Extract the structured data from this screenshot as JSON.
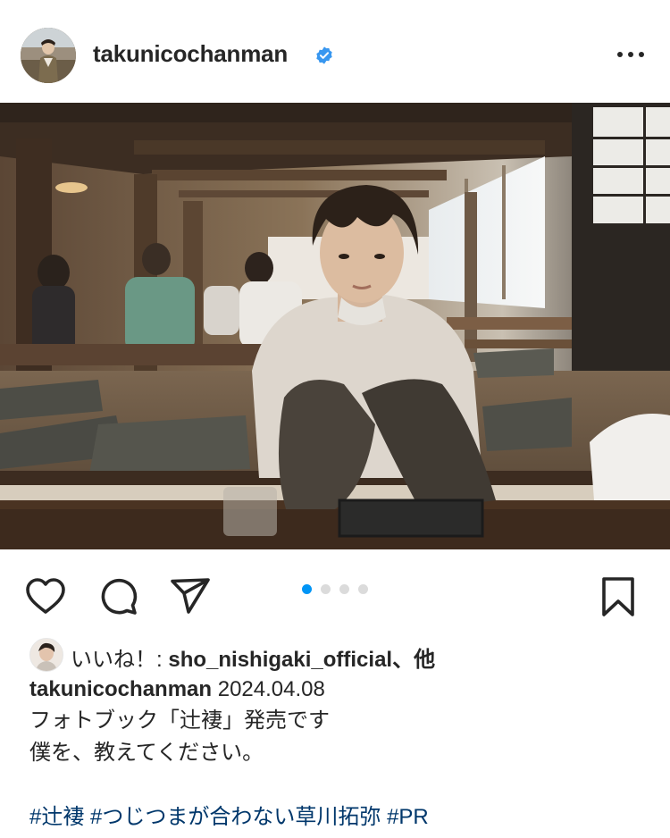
{
  "header": {
    "username": "takunicochanman",
    "verified": true,
    "more_icon": "more-horizontal-icon"
  },
  "post": {
    "image_alt": "photo-carousel-slide",
    "carousel": {
      "total": 4,
      "active": 1
    }
  },
  "actions": {
    "like_icon": "heart-icon",
    "comment_icon": "comment-icon",
    "share_icon": "send-icon",
    "save_icon": "bookmark-icon"
  },
  "likes": {
    "prefix": "いいね！: ",
    "user": "sho_nishigaki_official",
    "suffix": "、他"
  },
  "caption": {
    "user": "takunicochanman",
    "date": "2024.04.08",
    "line1": "フォトブック「辻褄」発売です",
    "line2": "僕を、教えてください。"
  },
  "hashtags": [
    "#辻褄",
    "#つじつまが合わない草川拓弥",
    "#PR"
  ],
  "colors": {
    "text": "#262626",
    "link": "#00376b",
    "active_dot": "#0095f6",
    "verified": "#3897f0"
  }
}
